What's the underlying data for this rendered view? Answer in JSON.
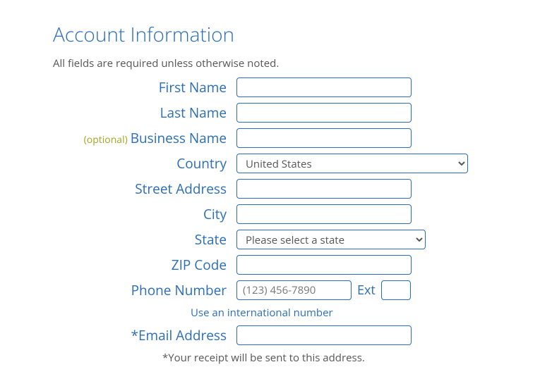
{
  "heading": "Account Information",
  "required_note": "All fields are required unless otherwise noted.",
  "labels": {
    "first_name": "First Name",
    "last_name": "Last Name",
    "business_name": "Business Name",
    "optional_tag": "(optional)",
    "country": "Country",
    "street_address": "Street Address",
    "city": "City",
    "state": "State",
    "zip": "ZIP Code",
    "phone": "Phone Number",
    "ext": "Ext",
    "email": "Email Address"
  },
  "values": {
    "country_selected": "United States",
    "state_selected": "Please select a state"
  },
  "placeholders": {
    "phone": "(123) 456-7890"
  },
  "intl_link": "Use an international number",
  "receipt_note": "*Your receipt will be sent to this address."
}
